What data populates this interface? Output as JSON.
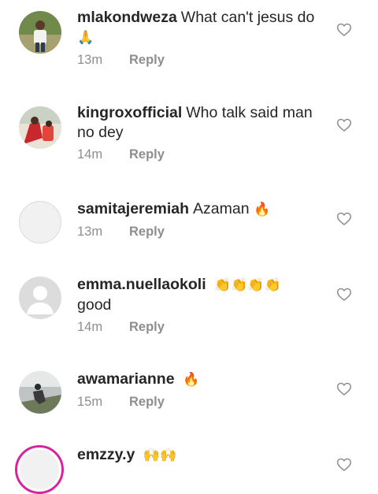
{
  "comments": [
    {
      "username": "mlakondweza",
      "text": "What can't jesus do",
      "emoji": "🙏",
      "time": "13m",
      "reply": "Reply"
    },
    {
      "username": "kingroxofficial",
      "text": "Who talk said man no dey",
      "emoji": "",
      "time": "14m",
      "reply": "Reply"
    },
    {
      "username": "samitajeremiah",
      "text": "Azaman",
      "emoji": "🔥",
      "time": "13m",
      "reply": "Reply"
    },
    {
      "username": "emma.nuellaokoli",
      "text": "good",
      "emoji": "👏👏👏👏",
      "time": "14m",
      "reply": "Reply"
    },
    {
      "username": "awamarianne",
      "text": "",
      "emoji": "🔥",
      "time": "15m",
      "reply": "Reply"
    },
    {
      "username": "emzzy.y",
      "text": "",
      "emoji": "🙌🙌",
      "time": "",
      "reply": ""
    }
  ],
  "icons": {
    "like": "heart-outline-icon"
  },
  "colors": {
    "meta": "#8e8e8e",
    "text": "#262626",
    "story_ring": "#d6249f"
  }
}
